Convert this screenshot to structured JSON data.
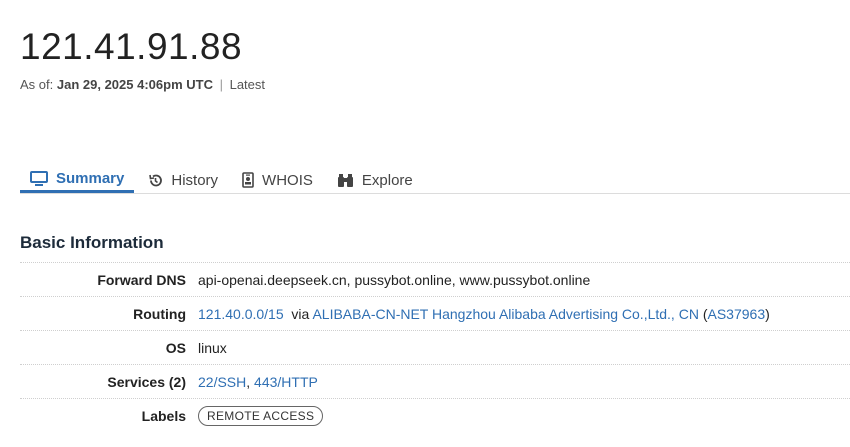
{
  "header": {
    "ip": "121.41.91.88",
    "as_of_label": "As of:",
    "as_of_date": "Jan 29, 2025 4:06pm UTC",
    "separator": "|",
    "latest": "Latest"
  },
  "tabs": [
    {
      "label": "Summary",
      "icon": "monitor-icon",
      "active": true
    },
    {
      "label": "History",
      "icon": "history-icon",
      "active": false
    },
    {
      "label": "WHOIS",
      "icon": "id-badge-icon",
      "active": false
    },
    {
      "label": "Explore",
      "icon": "binoculars-icon",
      "active": false
    }
  ],
  "basic_info": {
    "title": "Basic Information",
    "forward_dns": {
      "label": "Forward DNS",
      "value": "api-openai.deepseek.cn, pussybot.online, www.pussybot.online"
    },
    "routing": {
      "label": "Routing",
      "prefix": "121.40.0.0/15",
      "via": "via",
      "network": "ALIBABA-CN-NET Hangzhou Alibaba Advertising Co.,Ltd., CN",
      "open_paren": "(",
      "asn": "AS37963",
      "close_paren": ")"
    },
    "os": {
      "label": "OS",
      "value": "linux"
    },
    "services": {
      "label": "Services (2)",
      "items": [
        "22/SSH",
        "443/HTTP"
      ],
      "comma": ","
    },
    "labels": {
      "label": "Labels",
      "badge": "REMOTE ACCESS"
    }
  },
  "colors": {
    "accent": "#2f6fb3",
    "heading": "#1d2b3a"
  }
}
